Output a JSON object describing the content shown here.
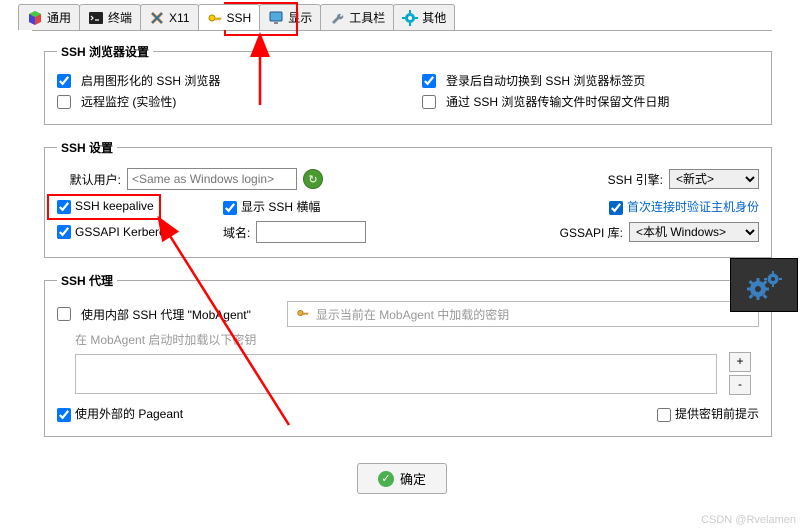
{
  "tabs": [
    {
      "label": "通用"
    },
    {
      "label": "终端"
    },
    {
      "label": "X11"
    },
    {
      "label": "SSH"
    },
    {
      "label": "显示"
    },
    {
      "label": "工具栏"
    },
    {
      "label": "其他"
    }
  ],
  "browser_settings": {
    "legend": "SSH 浏览器设置",
    "enable_gui": "启用图形化的 SSH 浏览器",
    "remote_monitor": "远程监控 (实验性)",
    "auto_switch": "登录后自动切换到 SSH 浏览器标签页",
    "preserve_date": "通过 SSH 浏览器传输文件时保留文件日期"
  },
  "ssh_settings": {
    "legend": "SSH 设置",
    "default_user_label": "默认用户:",
    "default_user_placeholder": "<Same as Windows login>",
    "engine_label": "SSH 引擎:",
    "engine_value": "<新式>",
    "keepalive": "SSH keepalive",
    "show_banner": "显示 SSH 横幅",
    "verify_host": "首次连接时验证主机身份",
    "gssapi": "GSSAPI Kerberos",
    "domain_label": "域名:",
    "gssapi_lib_label": "GSSAPI 库:",
    "gssapi_lib_value": "<本机 Windows>"
  },
  "ssh_agent": {
    "legend": "SSH 代理",
    "internal_agent": "使用内部 SSH 代理 \"MobAgent\"",
    "key_placeholder": "显示当前在 MobAgent 中加载的密钥",
    "load_keys_startup": "在 MobAgent 启动时加载以下密钥",
    "plus": "+",
    "minus": "-",
    "external_pageant": "使用外部的 Pageant",
    "prompt_key": "提供密钥前提示"
  },
  "ok_button": "确定",
  "watermark": "CSDN @Rvelamen"
}
